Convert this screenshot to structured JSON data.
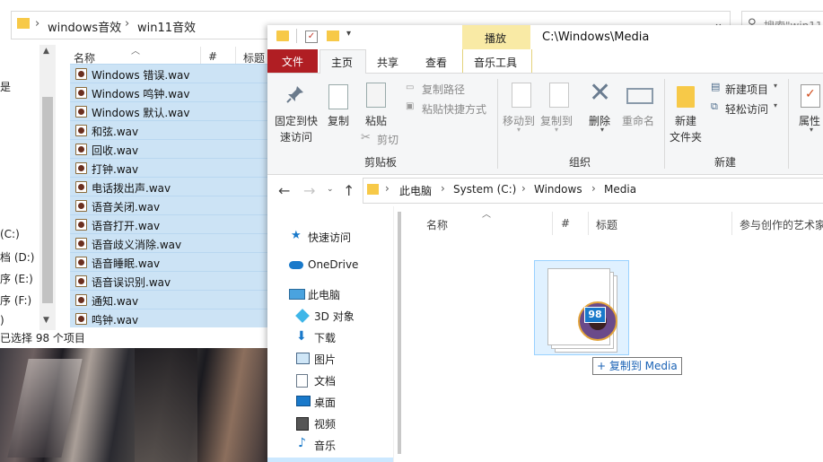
{
  "bg_window": {
    "breadcrumb": [
      "windows音效",
      "win11音效"
    ],
    "search_placeholder": "搜索\"win11...",
    "drives": [
      "(C:)",
      "档 (D:)",
      "序 (E:)",
      "序 (F:)",
      ")"
    ],
    "left_top_fragment": "是",
    "columns": {
      "name": "名称",
      "number": "#",
      "title": "标题"
    },
    "files": [
      "Windows 错误.wav",
      "Windows 鸣钟.wav",
      "Windows 默认.wav",
      "和弦.wav",
      "回收.wav",
      "打钟.wav",
      "电话拨出声.wav",
      "语音关闭.wav",
      "语音打开.wav",
      "语音歧义消除.wav",
      "语音睡眠.wav",
      "语音误识别.wav",
      "通知.wav",
      "鸣钟.wav"
    ],
    "status": "已选择 98 个项目"
  },
  "fg_window": {
    "context_tab": "播放",
    "title": "C:\\Windows\\Media",
    "tabs": {
      "file": "文件",
      "home": "主页",
      "share": "共享",
      "view": "查看",
      "music_tools": "音乐工具"
    },
    "ribbon": {
      "pin_line1": "固定到快",
      "pin_line2": "速访问",
      "copy": "复制",
      "paste": "粘贴",
      "copy_path": "复制路径",
      "paste_shortcut": "粘贴快捷方式",
      "cut": "剪切",
      "group_clipboard": "剪贴板",
      "move_to": "移动到",
      "copy_to": "复制到",
      "delete": "删除",
      "rename": "重命名",
      "group_organize": "组织",
      "new_folder_line1": "新建",
      "new_folder_line2": "文件夹",
      "new_item": "新建项目",
      "easy_access": "轻松访问",
      "group_new": "新建",
      "properties": "属性"
    },
    "address": [
      "此电脑",
      "System (C:)",
      "Windows",
      "Media"
    ],
    "nav_items": [
      {
        "label": "快速访问",
        "icon": "star-icon"
      },
      {
        "label": "OneDrive",
        "icon": "cloud-icon"
      },
      {
        "label": "此电脑",
        "icon": "computer-icon"
      },
      {
        "label": "3D 对象",
        "icon": "cube-icon"
      },
      {
        "label": "下载",
        "icon": "download-icon"
      },
      {
        "label": "图片",
        "icon": "picture-icon"
      },
      {
        "label": "文档",
        "icon": "document-icon"
      },
      {
        "label": "桌面",
        "icon": "desktop-icon"
      },
      {
        "label": "视频",
        "icon": "video-icon"
      },
      {
        "label": "音乐",
        "icon": "music-icon"
      }
    ],
    "content_columns": {
      "name": "名称",
      "number": "#",
      "title": "标题",
      "artists": "参与创作的艺术家"
    },
    "drag_count": "98",
    "drag_tooltip": "+ 复制到 Media"
  },
  "colors": {
    "file_tab": "#b01e23",
    "context_tab": "#f9eaa5",
    "selection": "#cce3f5",
    "accent": "#1979ca"
  }
}
